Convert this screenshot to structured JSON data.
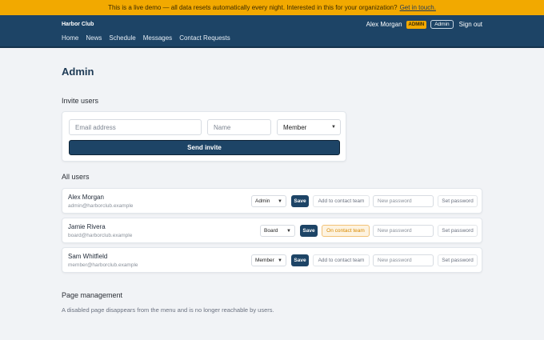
{
  "banner": {
    "text": "This is a live demo — all data resets automatically every night. Interested in this for your organization?",
    "link": "Get in touch."
  },
  "header": {
    "brand": "Harbor Club",
    "nav": [
      "Home",
      "News",
      "Schedule",
      "Messages",
      "Contact Requests"
    ],
    "user_name": "Alex Morgan",
    "role_badge": "ADMIN",
    "admin_button": "Admin",
    "sign_out": "Sign out"
  },
  "page": {
    "title": "Admin"
  },
  "invite": {
    "section_title": "Invite users",
    "email_placeholder": "Email address",
    "name_placeholder": "Name",
    "role_value": "Member",
    "send_label": "Send invite"
  },
  "all_users": {
    "section_title": "All users",
    "users": [
      {
        "name": "Alex Morgan",
        "email": "admin@harborclub.example",
        "role": "Admin",
        "save": "Save",
        "contact": "Add to contact team",
        "contact_active": false,
        "password_placeholder": "New password",
        "set_password": "Set password"
      },
      {
        "name": "Jamie Rivera",
        "email": "board@harborclub.example",
        "role": "Board",
        "save": "Save",
        "contact": "On contact team",
        "contact_active": true,
        "password_placeholder": "New password",
        "set_password": "Set password"
      },
      {
        "name": "Sam Whitfield",
        "email": "member@harborclub.example",
        "role": "Member",
        "save": "Save",
        "contact": "Add to contact team",
        "contact_active": false,
        "password_placeholder": "New password",
        "set_password": "Set password"
      }
    ]
  },
  "page_management": {
    "section_title": "Page management",
    "note": "A disabled page disappears from the menu and is no longer reachable by users."
  },
  "colors": {
    "banner": "#f2a900",
    "header": "#1d4466",
    "primary_button": "#1d4466",
    "contact_active": "#fdf3e1"
  }
}
